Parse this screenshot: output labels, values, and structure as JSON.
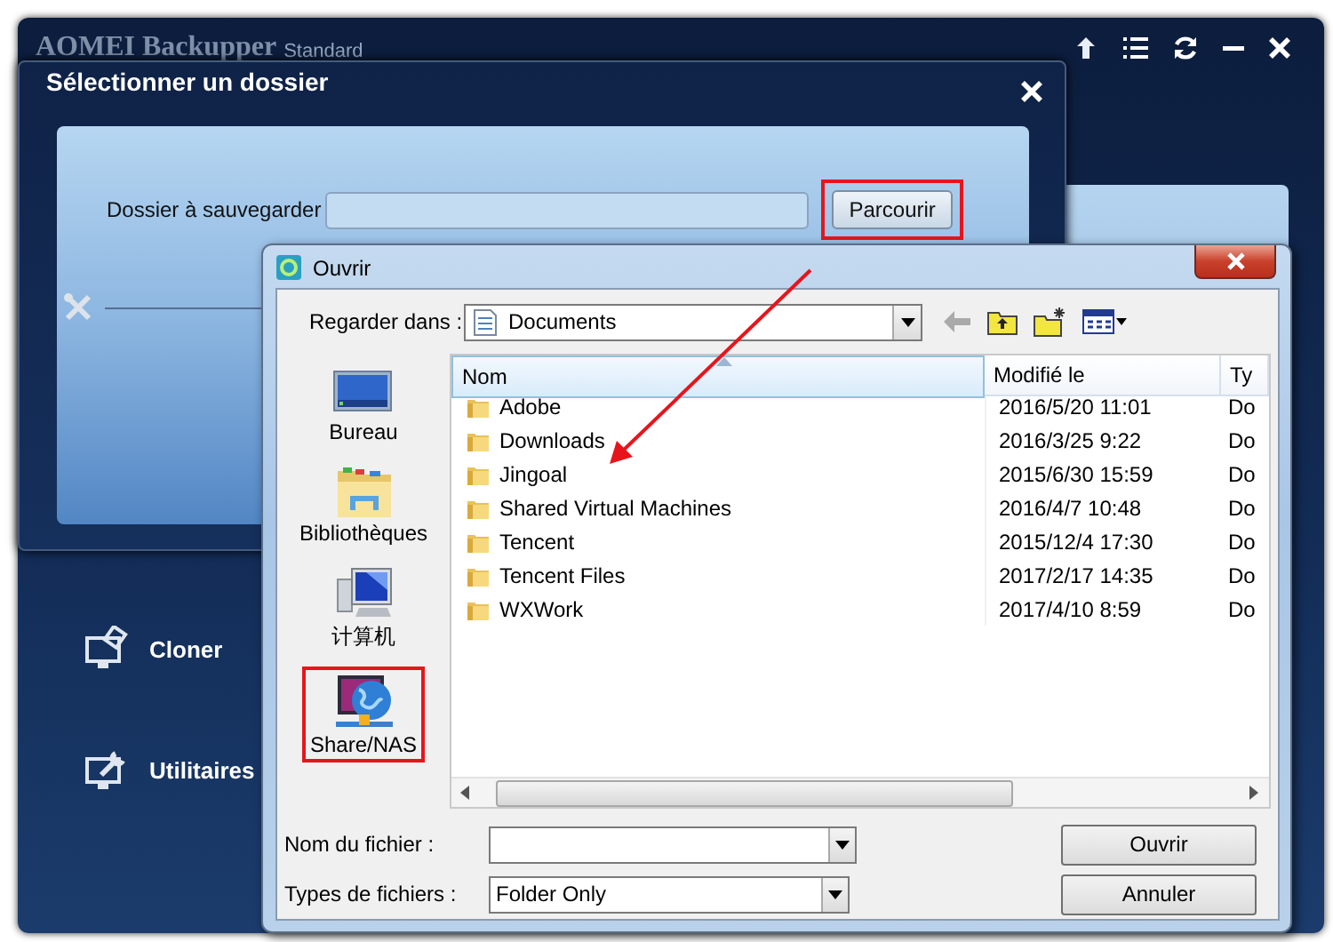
{
  "app_window": {
    "title": "AOMEI Backupper",
    "edition": "Standard",
    "nav_items": [
      {
        "label": "Cloner",
        "kind": "clone"
      },
      {
        "label": "Utilitaires",
        "kind": "tools"
      }
    ]
  },
  "select_dialog": {
    "title": "Sélectionner un dossier",
    "field_label": "Dossier à sauvegarder",
    "browse_button": {
      "label": "Parcourir",
      "highlighted": true
    }
  },
  "open_dialog": {
    "title": "Ouvrir",
    "look_in_label": "Regarder dans :",
    "look_in_value": "Documents",
    "places": [
      {
        "label": "Bureau",
        "kind": "desktop",
        "highlighted": false
      },
      {
        "label": "Bibliothèques",
        "kind": "library",
        "highlighted": false
      },
      {
        "label": "计算机",
        "kind": "computer",
        "highlighted": false
      },
      {
        "label": "Share/NAS",
        "kind": "network",
        "highlighted": true
      }
    ],
    "columns": [
      "Nom",
      "Modifié le",
      "Ty"
    ],
    "rows": [
      {
        "name": "Adobe",
        "modified": "2016/5/20 11:01",
        "type": "Do"
      },
      {
        "name": "Downloads",
        "modified": "2016/3/25 9:22",
        "type": "Do"
      },
      {
        "name": "Jingoal",
        "modified": "2015/6/30 15:59",
        "type": "Do"
      },
      {
        "name": "Shared Virtual Machines",
        "modified": "2016/4/7 10:48",
        "type": "Do"
      },
      {
        "name": "Tencent",
        "modified": "2015/12/4 17:30",
        "type": "Do"
      },
      {
        "name": "Tencent Files",
        "modified": "2017/2/17 14:35",
        "type": "Do"
      },
      {
        "name": "WXWork",
        "modified": "2017/4/10 8:59",
        "type": "Do"
      }
    ],
    "filename_label": "Nom du fichier :",
    "filetype_label": "Types de fichiers :",
    "filetype_value": "Folder Only",
    "buttons": [
      "Ouvrir",
      "Annuler"
    ]
  }
}
